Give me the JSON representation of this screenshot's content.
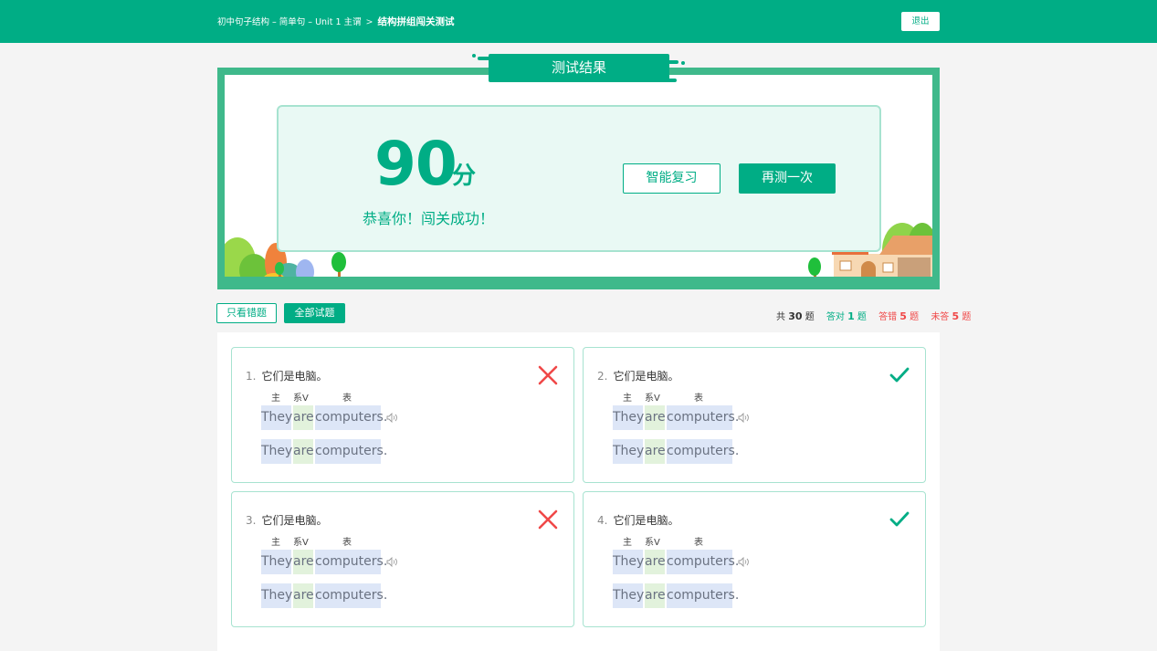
{
  "breadcrumb": {
    "items": [
      "初中句子结构 – 简单句 – Unit 1 主谓"
    ],
    "separator": ">",
    "current": "结构拼组闯关测试"
  },
  "header": {
    "exit_label": "退出"
  },
  "result": {
    "title": "测试结果",
    "score": "90",
    "score_unit": "分",
    "message": "恭喜你！闯关成功！",
    "review_label": "智能复习",
    "retry_label": "再测一次"
  },
  "filters": {
    "wrong_only": "只看错题",
    "all": "全部试题"
  },
  "stats": {
    "total_prefix": "共",
    "total": "30",
    "total_suffix": "题",
    "right_prefix": "答对",
    "right": "1",
    "right_suffix": "题",
    "wrong_prefix": "答错",
    "wrong": "5",
    "wrong_suffix": "题",
    "unanswered_prefix": "未答",
    "unanswered": "5",
    "unanswered_suffix": "题"
  },
  "colors": {
    "accent": "#00ad85",
    "wrong": "#f04848",
    "subject_bg": "#dde6f7",
    "verb_bg": "#e2f2dc"
  },
  "questions": [
    {
      "no": "1.",
      "text": "它们是电脑。",
      "roles": [
        "主",
        "系V",
        "表"
      ],
      "answer": [
        "They",
        "are",
        "computers."
      ],
      "correct": [
        "They",
        "are",
        "computers."
      ],
      "result": "wrong",
      "result_icon": "cross-icon"
    },
    {
      "no": "2.",
      "text": "它们是电脑。",
      "roles": [
        "主",
        "系V",
        "表"
      ],
      "answer": [
        "They",
        "are",
        "computers."
      ],
      "correct": [
        "They",
        "are",
        "computers."
      ],
      "result": "right",
      "result_icon": "check-icon"
    },
    {
      "no": "3.",
      "text": "它们是电脑。",
      "roles": [
        "主",
        "系V",
        "表"
      ],
      "answer": [
        "They",
        "are",
        "computers."
      ],
      "correct": [
        "They",
        "are",
        "computers."
      ],
      "result": "wrong",
      "result_icon": "cross-icon"
    },
    {
      "no": "4.",
      "text": "它们是电脑。",
      "roles": [
        "主",
        "系V",
        "表"
      ],
      "answer": [
        "They",
        "are",
        "computers."
      ],
      "correct": [
        "They",
        "are",
        "computers."
      ],
      "result": "right",
      "result_icon": "check-icon"
    }
  ]
}
